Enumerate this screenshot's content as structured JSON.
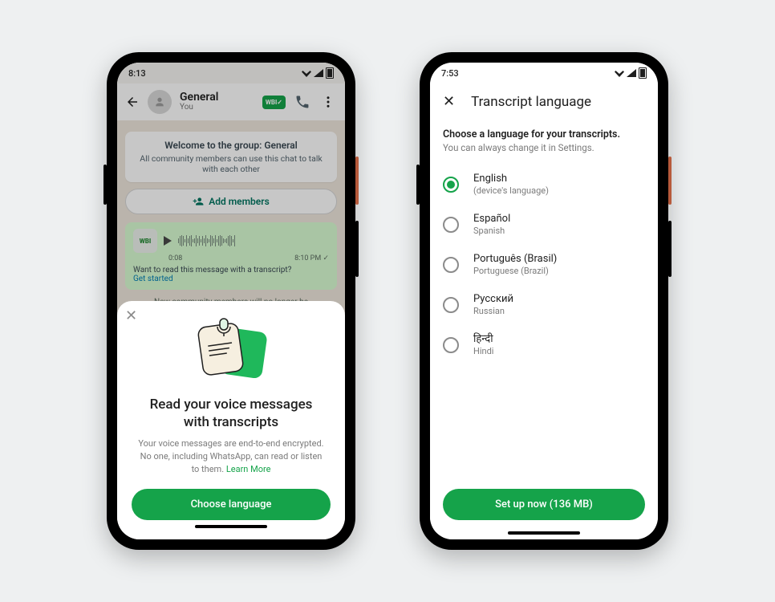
{
  "left": {
    "status_time": "8:13",
    "chat": {
      "title": "General",
      "subtitle": "You",
      "welcome_heading": "Welcome to the group: General",
      "welcome_body": "All community members can use this chat to talk with each other",
      "add_members": "Add members",
      "voice_time": "0:08",
      "voice_stamp": "8:10 PM",
      "transcript_prompt": "Want to read this message with a transcript?",
      "get_started": "Get started",
      "divider_text": "New community members will no longer be"
    },
    "sheet": {
      "title": "Read your voice messages with transcripts",
      "body": "Your voice messages are end-to-end encrypted. No one, including WhatsApp, can read or listen to them.",
      "learn_more": "Learn More",
      "cta": "Choose language"
    }
  },
  "right": {
    "status_time": "7:53",
    "title": "Transcript language",
    "heading": "Choose a language for your transcripts.",
    "subheading": "You can always change it in Settings.",
    "languages": [
      {
        "name": "English",
        "sub": "(device's language)",
        "checked": true
      },
      {
        "name": "Español",
        "sub": "Spanish",
        "checked": false
      },
      {
        "name": "Português (Brasil)",
        "sub": "Portuguese (Brazil)",
        "checked": false
      },
      {
        "name": "Русский",
        "sub": "Russian",
        "checked": false
      },
      {
        "name": "हिन्दी",
        "sub": "Hindi",
        "checked": false
      }
    ],
    "cta": "Set up now (136 MB)"
  }
}
